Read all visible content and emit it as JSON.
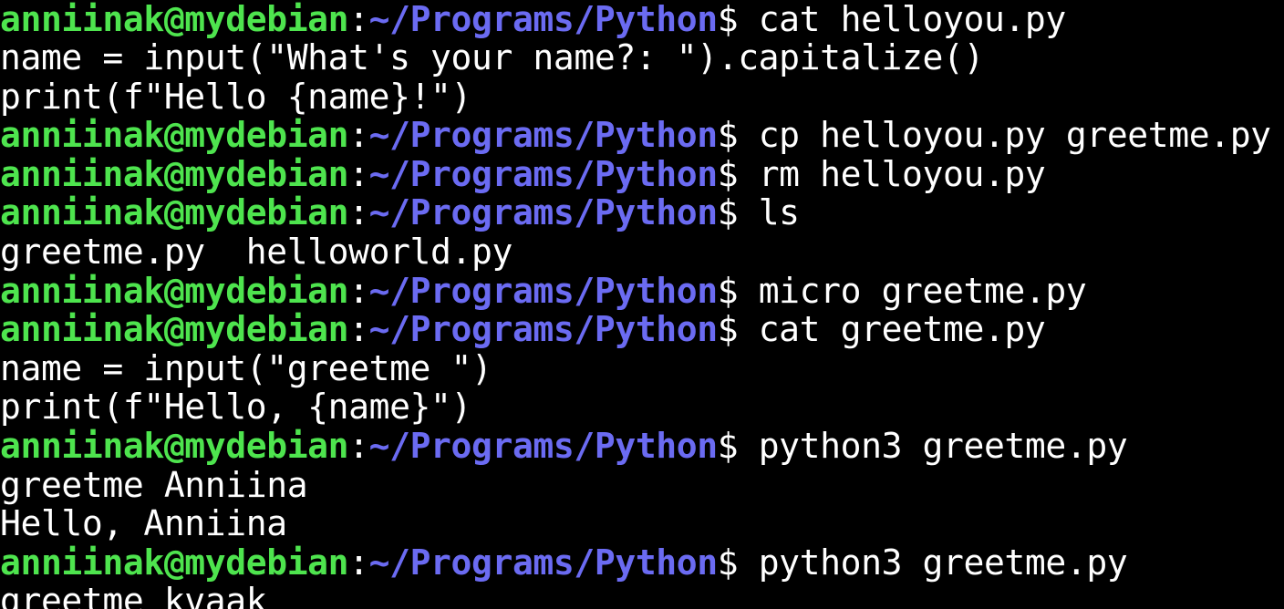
{
  "colors": {
    "background": "#000000",
    "user_host": "#4ee44e",
    "path": "#6b6bf2",
    "text": "#ffffff"
  },
  "terminal": {
    "lines": [
      {
        "type": "prompt",
        "user": "anniinak@mydebian",
        "sep": ":",
        "path": "~/Programs/Python",
        "symbol": "$",
        "command": " cat helloyou.py"
      },
      {
        "type": "output",
        "text": "name = input(\"What's your name?: \").capitalize()"
      },
      {
        "type": "output",
        "text": "print(f\"Hello {name}!\")"
      },
      {
        "type": "prompt",
        "user": "anniinak@mydebian",
        "sep": ":",
        "path": "~/Programs/Python",
        "symbol": "$",
        "command": " cp helloyou.py greetme.py"
      },
      {
        "type": "prompt",
        "user": "anniinak@mydebian",
        "sep": ":",
        "path": "~/Programs/Python",
        "symbol": "$",
        "command": " rm helloyou.py"
      },
      {
        "type": "prompt",
        "user": "anniinak@mydebian",
        "sep": ":",
        "path": "~/Programs/Python",
        "symbol": "$",
        "command": " ls"
      },
      {
        "type": "output",
        "text": "greetme.py  helloworld.py"
      },
      {
        "type": "prompt",
        "user": "anniinak@mydebian",
        "sep": ":",
        "path": "~/Programs/Python",
        "symbol": "$",
        "command": " micro greetme.py"
      },
      {
        "type": "prompt",
        "user": "anniinak@mydebian",
        "sep": ":",
        "path": "~/Programs/Python",
        "symbol": "$",
        "command": " cat greetme.py"
      },
      {
        "type": "output",
        "text": "name = input(\"greetme \")"
      },
      {
        "type": "output",
        "text": "print(f\"Hello, {name}\")"
      },
      {
        "type": "prompt",
        "user": "anniinak@mydebian",
        "sep": ":",
        "path": "~/Programs/Python",
        "symbol": "$",
        "command": " python3 greetme.py"
      },
      {
        "type": "output",
        "text": "greetme Anniina"
      },
      {
        "type": "output",
        "text": "Hello, Anniina"
      },
      {
        "type": "prompt",
        "user": "anniinak@mydebian",
        "sep": ":",
        "path": "~/Programs/Python",
        "symbol": "$",
        "command": " python3 greetme.py"
      },
      {
        "type": "output",
        "text": "greetme kvaak"
      }
    ]
  }
}
